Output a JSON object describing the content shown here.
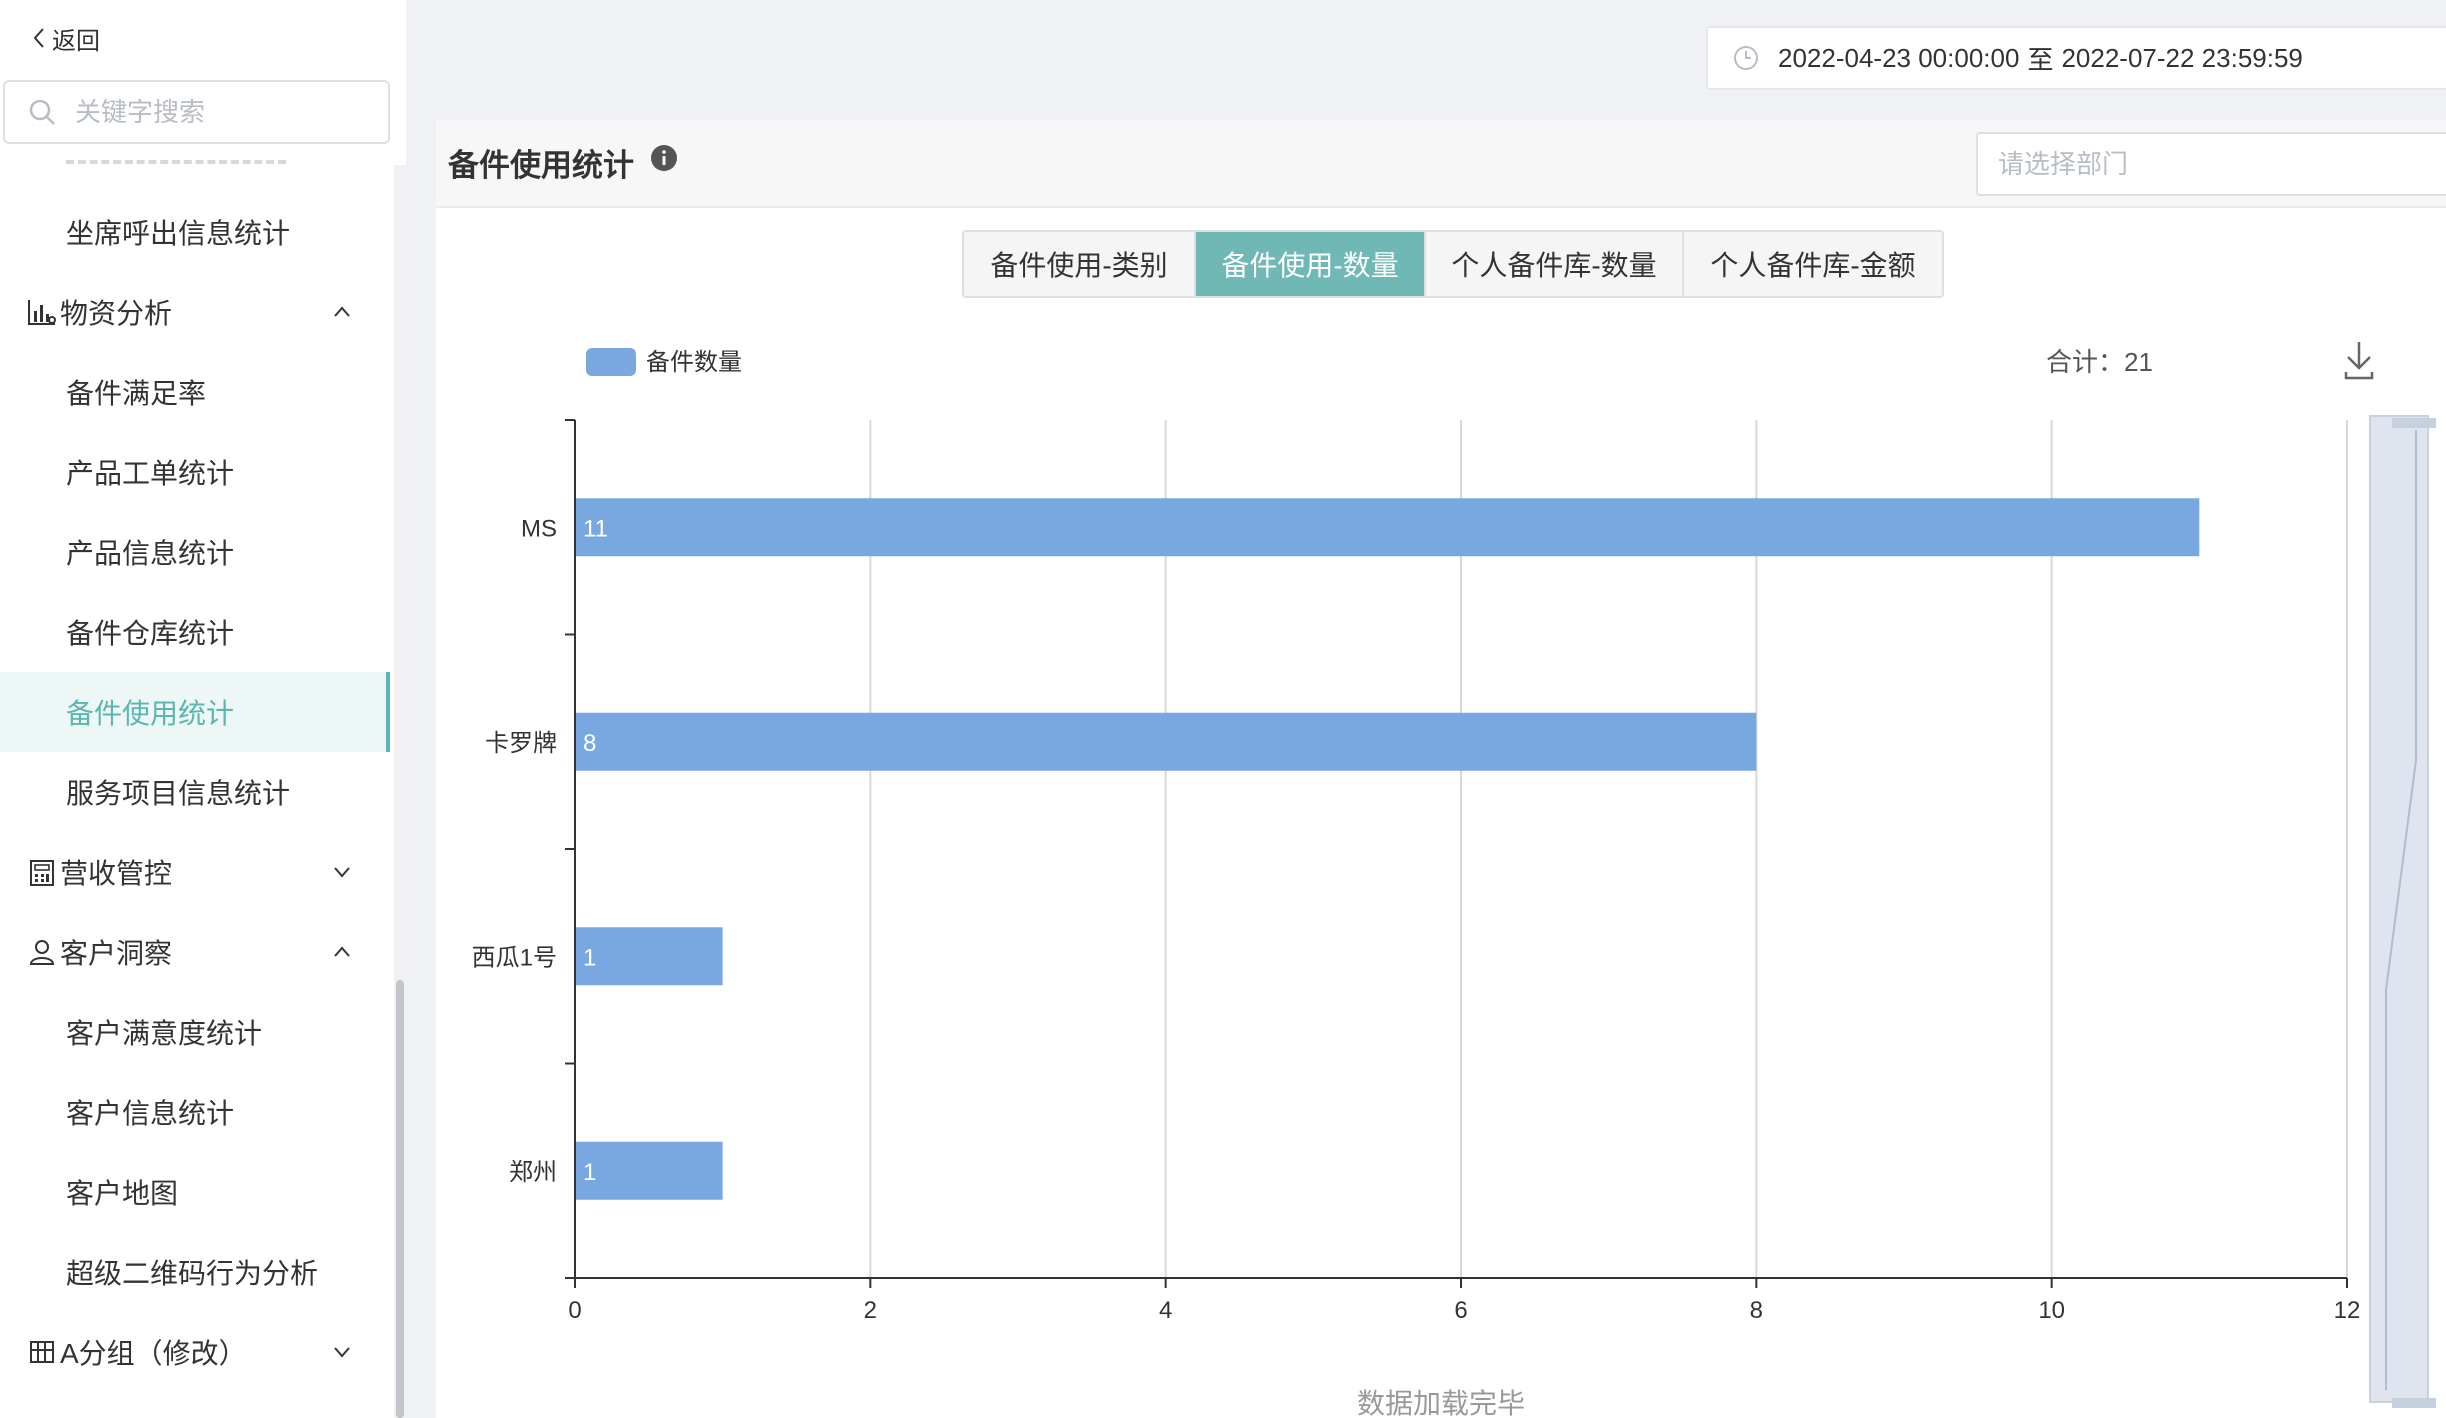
{
  "sidebar": {
    "back_label": "返回",
    "search_placeholder": "关键字搜索",
    "items": [
      {
        "label": "坐席呼出信息统计",
        "type": "item"
      },
      {
        "label": "物资分析",
        "type": "group",
        "icon": "bar-chart-icon",
        "expanded": true
      },
      {
        "label": "备件满足率",
        "type": "item"
      },
      {
        "label": "产品工单统计",
        "type": "item"
      },
      {
        "label": "产品信息统计",
        "type": "item"
      },
      {
        "label": "备件仓库统计",
        "type": "item"
      },
      {
        "label": "备件使用统计",
        "type": "item",
        "active": true
      },
      {
        "label": "服务项目信息统计",
        "type": "item"
      },
      {
        "label": "营收管控",
        "type": "group",
        "icon": "calculator-icon",
        "expanded": false
      },
      {
        "label": "客户洞察",
        "type": "group",
        "icon": "user-icon",
        "expanded": true
      },
      {
        "label": "客户满意度统计",
        "type": "item"
      },
      {
        "label": "客户信息统计",
        "type": "item"
      },
      {
        "label": "客户地图",
        "type": "item"
      },
      {
        "label": "超级二维码行为分析",
        "type": "item"
      },
      {
        "label": "A分组（修改）",
        "type": "group",
        "icon": "board-icon",
        "expanded": false
      }
    ]
  },
  "daterange": {
    "start": "2022-04-23 00:00:00",
    "separator": "至",
    "end": "2022-07-22 23:59:59"
  },
  "panel": {
    "title": "备件使用统计",
    "dept_placeholder": "请选择部门",
    "tabs": [
      {
        "label": "备件使用-类别",
        "active": false
      },
      {
        "label": "备件使用-数量",
        "active": true
      },
      {
        "label": "个人备件库-数量",
        "active": false
      },
      {
        "label": "个人备件库-金额",
        "active": false
      }
    ],
    "total_label": "合计：21",
    "status": "数据加载完毕"
  },
  "colors": {
    "accent": "#6fb8b5",
    "bar": "#79a8e0"
  },
  "chart_data": {
    "type": "bar",
    "orientation": "horizontal",
    "categories": [
      "MS",
      "卡罗牌",
      "西瓜1号",
      "郑州"
    ],
    "series": [
      {
        "name": "备件数量",
        "values": [
          11,
          8,
          1,
          1
        ]
      }
    ],
    "xlim": [
      0,
      12
    ],
    "xticks": [
      0,
      2,
      4,
      6,
      8,
      10,
      12
    ],
    "grid": true,
    "legend": "top-left",
    "data_labels": true,
    "total": 21
  }
}
